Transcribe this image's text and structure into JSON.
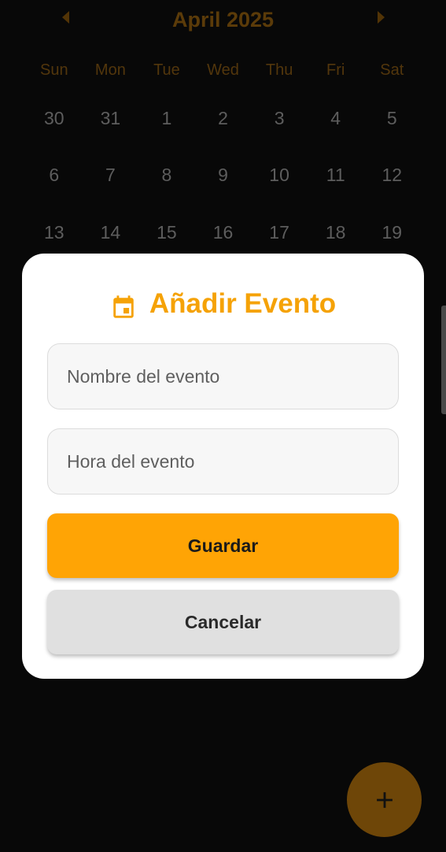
{
  "calendar": {
    "month_label": "April 2025",
    "weekdays": [
      "Sun",
      "Mon",
      "Tue",
      "Wed",
      "Thu",
      "Fri",
      "Sat"
    ],
    "weeks": [
      [
        "30",
        "31",
        "1",
        "2",
        "3",
        "4",
        "5"
      ],
      [
        "6",
        "7",
        "8",
        "9",
        "10",
        "11",
        "12"
      ],
      [
        "13",
        "14",
        "15",
        "16",
        "17",
        "18",
        "19"
      ]
    ]
  },
  "dialog": {
    "title": "Añadir Evento",
    "name_placeholder": "Nombre del evento",
    "time_placeholder": "Hora del evento",
    "save_label": "Guardar",
    "cancel_label": "Cancelar"
  },
  "icons": {
    "prev": "chevron-left-icon",
    "next": "chevron-right-icon",
    "title": "calendar-event-icon",
    "fab": "plus-icon"
  },
  "colors": {
    "accent": "#ffa405",
    "title": "#f5a206",
    "dimmed_accent": "#6e4608",
    "background": "#0b0b0b"
  }
}
